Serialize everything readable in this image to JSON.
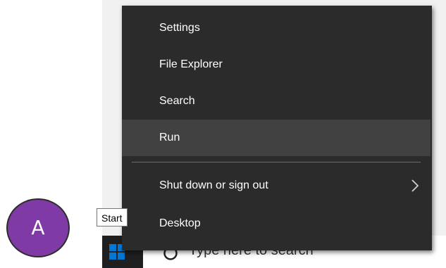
{
  "menu": {
    "items": [
      {
        "label": "Settings"
      },
      {
        "label": "File Explorer"
      },
      {
        "label": "Search"
      },
      {
        "label": "Run"
      },
      {
        "label": "Shut down or sign out"
      },
      {
        "label": "Desktop"
      }
    ],
    "hovered": "Run"
  },
  "tooltip": {
    "text": "Start"
  },
  "taskbar": {
    "search_placeholder": "Type here to search",
    "start_icon": "windows-logo-icon",
    "search_icon": "search-circle-icon"
  },
  "annotation": {
    "label": "A",
    "color": "#7f3aa6"
  },
  "colors": {
    "menu_bg": "#2b2b2b",
    "menu_hover": "#414141",
    "menu_text": "#ffffff",
    "start_accent": "#0078d7"
  }
}
